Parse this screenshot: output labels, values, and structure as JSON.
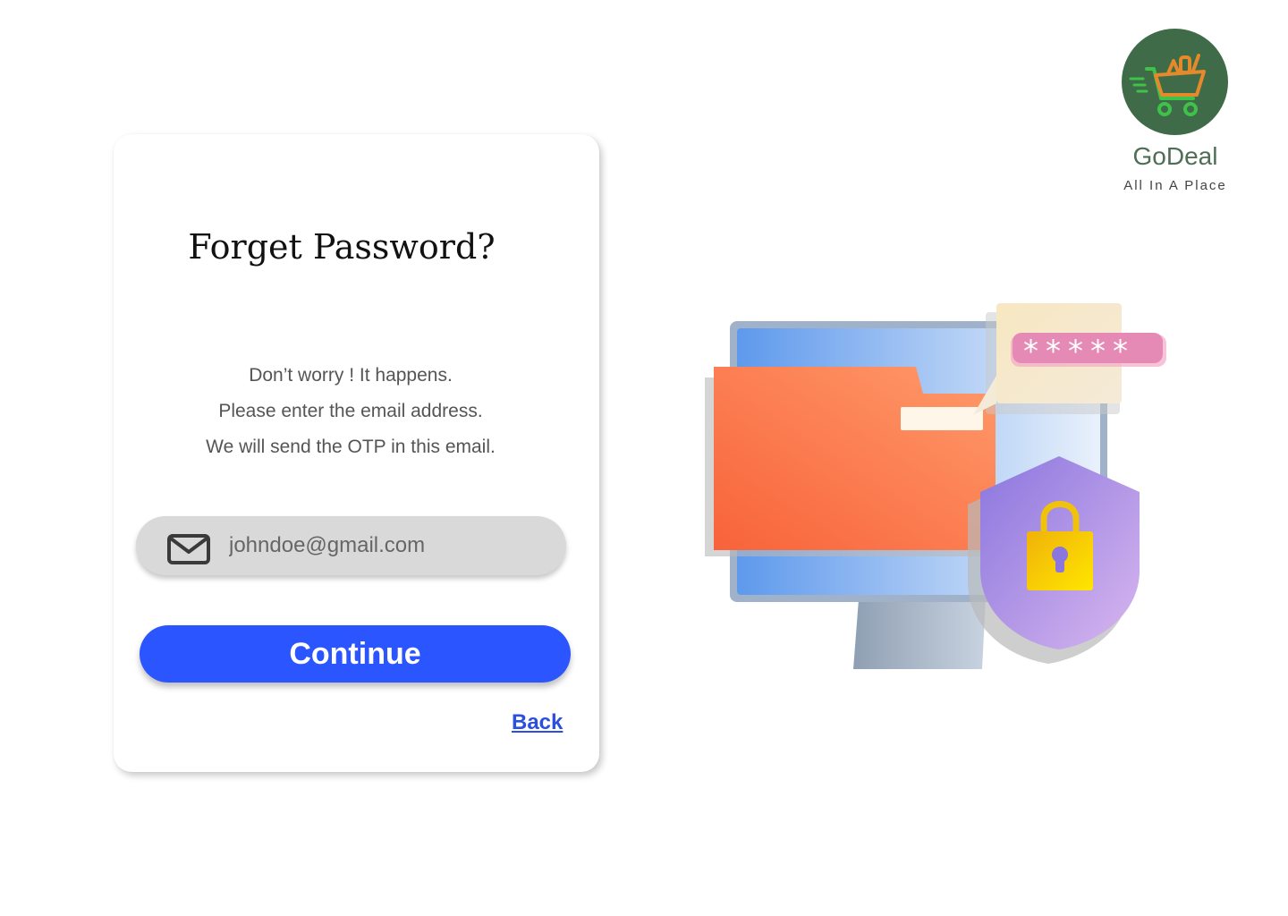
{
  "card": {
    "title": "Forget Password?",
    "description": [
      "Don’t worry ! It happens.",
      "Please enter the email address.",
      "We will send the OTP in this email."
    ],
    "email": {
      "placeholder": "johndoe@gmail.com",
      "icon": "mail-icon"
    },
    "continue_label": "Continue",
    "back_label": "Back"
  },
  "logo": {
    "name": "GoDeal",
    "tagline": "All In A Place",
    "icon": "shopping-cart-icon"
  },
  "illustration": {
    "password_mask": "*****",
    "icons": [
      "monitor-icon",
      "folder-icon",
      "speech-bubble-icon",
      "shield-lock-icon"
    ]
  },
  "colors": {
    "primary": "#2b55ff",
    "logo_bg": "#3f6b48",
    "field_bg": "#d9d9d9"
  }
}
